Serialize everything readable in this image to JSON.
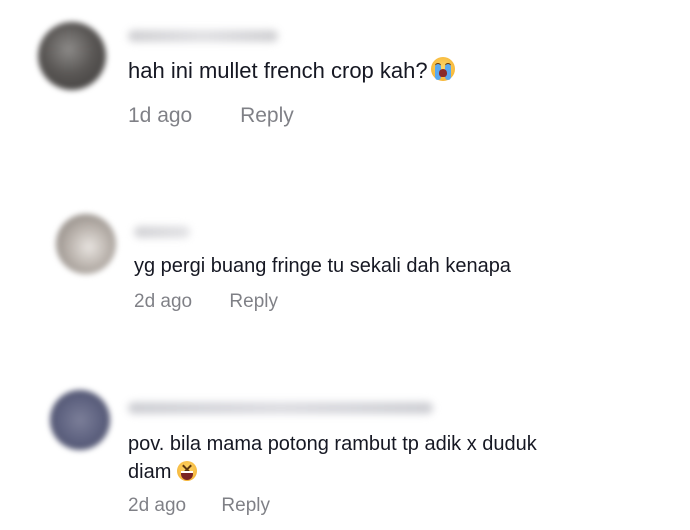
{
  "comments": [
    {
      "text": "hah ini mullet french crop kah?",
      "emoji": "crying-face-icon",
      "time": "1d ago",
      "reply_label": "Reply"
    },
    {
      "text": "yg pergi buang fringe tu sekali dah kenapa",
      "time": "2d ago",
      "reply_label": "Reply"
    },
    {
      "text_line1": "pov. bila mama potong rambut tp adik x duduk",
      "text_line2": "diam",
      "emoji": "laughing-face-icon",
      "time": "2d ago",
      "reply_label": "Reply"
    }
  ],
  "colors": {
    "text": "#161823",
    "meta": "#8a8b91",
    "background": "#ffffff"
  }
}
